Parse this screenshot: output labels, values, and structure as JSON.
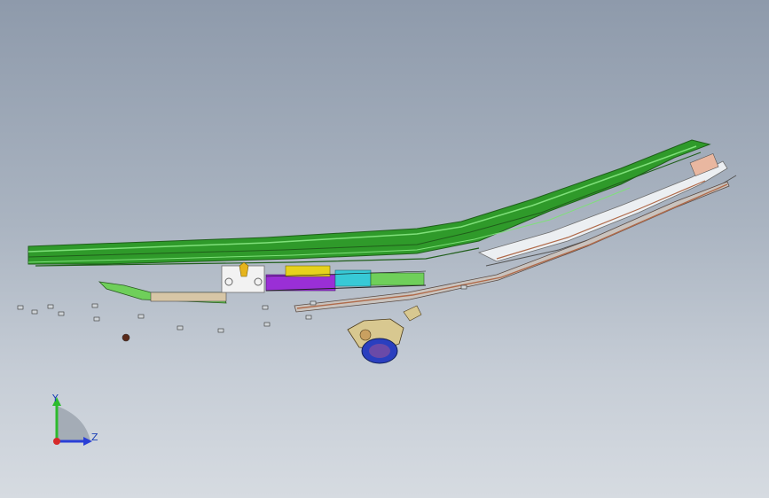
{
  "viewport": {
    "background_top": "#8e9aab",
    "background_bottom": "#d6dbe1",
    "view_mode": "shaded-with-edges"
  },
  "model": {
    "description_icon": "seat-rail-assembly-3d-model",
    "colors": {
      "rail_green": "#2f9a2a",
      "rail_dark": "#1f5e1a",
      "purple_part": "#9a2fd6",
      "yellow_part": "#e6d21c",
      "cyan_part": "#37c9d6",
      "copper_rod": "#b06a4a",
      "motor_blue": "#2a3fbf"
    }
  },
  "triad": {
    "y_label": "Y",
    "z_label": "Z",
    "y_color": "#2dbb2d",
    "z_color": "#2a3fd6",
    "x_color": "#d62a2a"
  }
}
